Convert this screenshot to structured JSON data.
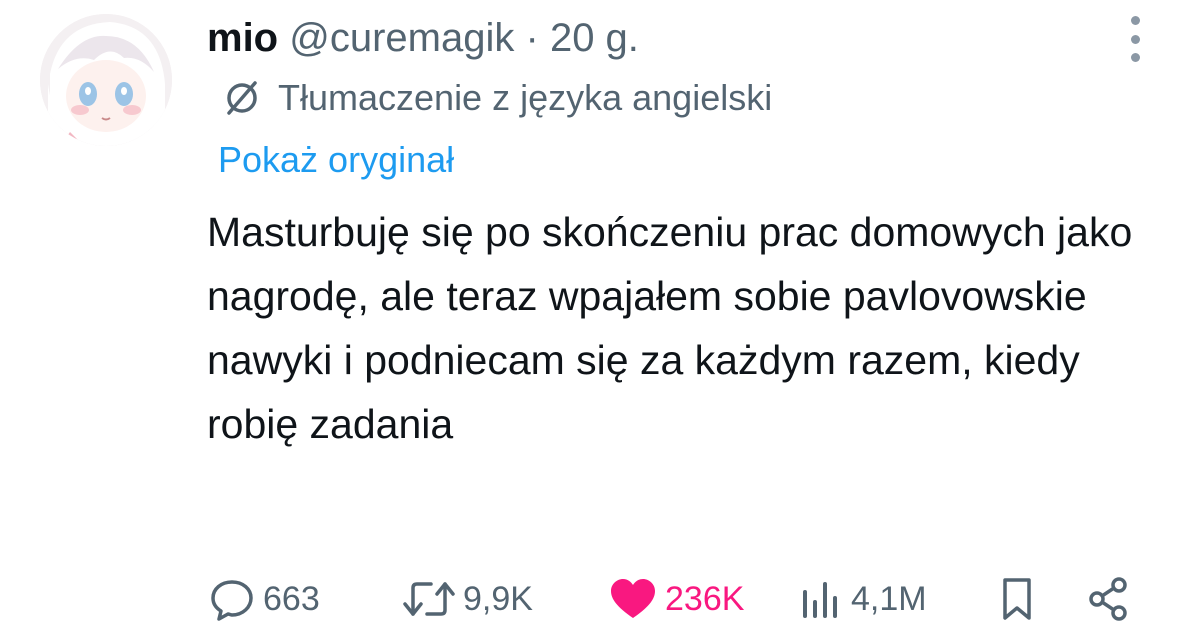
{
  "author": {
    "name": "mio",
    "handle": "@curemagik",
    "separator": "·",
    "time": "20 g."
  },
  "translation": {
    "notice": "Tłumaczenie z języka angielski",
    "show_original": "Pokaż oryginał"
  },
  "tweet": {
    "text": "Masturbuję się po skończeniu prac domowych jako nagrodę, ale teraz wpajałem sobie pavlovowskie nawyki i podniecam się za każdym razem, kiedy robię zadania"
  },
  "actions": {
    "replies": "663",
    "retweets": "9,9K",
    "likes": "236K",
    "views": "4,1M"
  },
  "colors": {
    "link": "#1d9bf0",
    "like": "#f91880",
    "muted": "#536471",
    "text": "#0f1419"
  },
  "icons": [
    "avatar",
    "more-icon",
    "translate-icon",
    "reply-icon",
    "retweet-icon",
    "like-icon",
    "views-icon",
    "bookmark-icon",
    "share-icon"
  ]
}
